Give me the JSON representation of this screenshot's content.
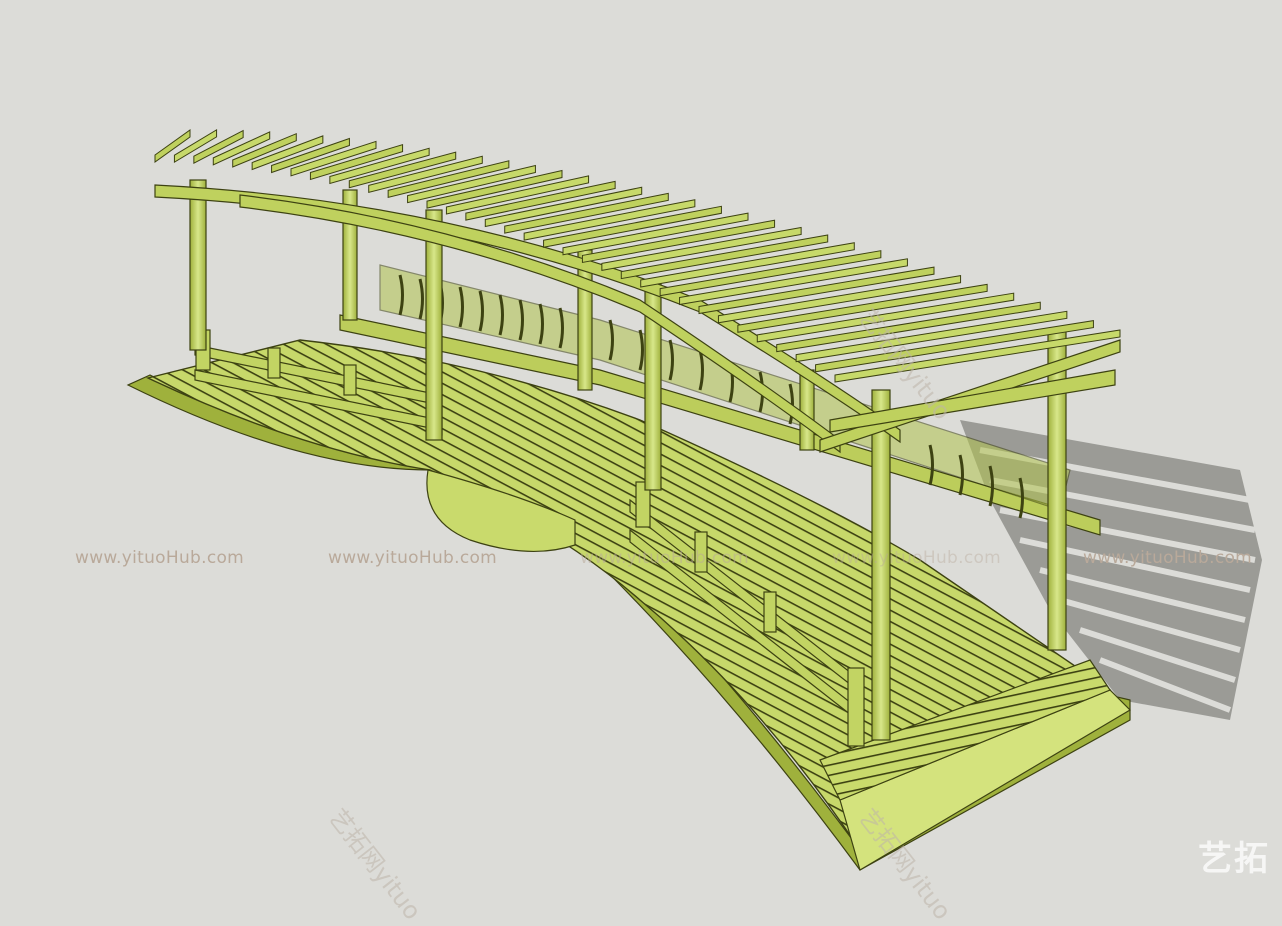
{
  "watermark": {
    "url_text": "www.yituoHub.com",
    "url_repeats": 5,
    "diagonal_text": "艺拓网yituo",
    "logo_text": "艺拓"
  },
  "model": {
    "description_icon": "pergola-bridge-3d-model",
    "colors": {
      "background": "#dcdcd8",
      "wood_light": "#cfe07a",
      "wood_mid": "#b7c955",
      "wood_dark": "#7f8c2c",
      "edge": "#3d4212",
      "shadow": "#8f8f8b"
    }
  }
}
